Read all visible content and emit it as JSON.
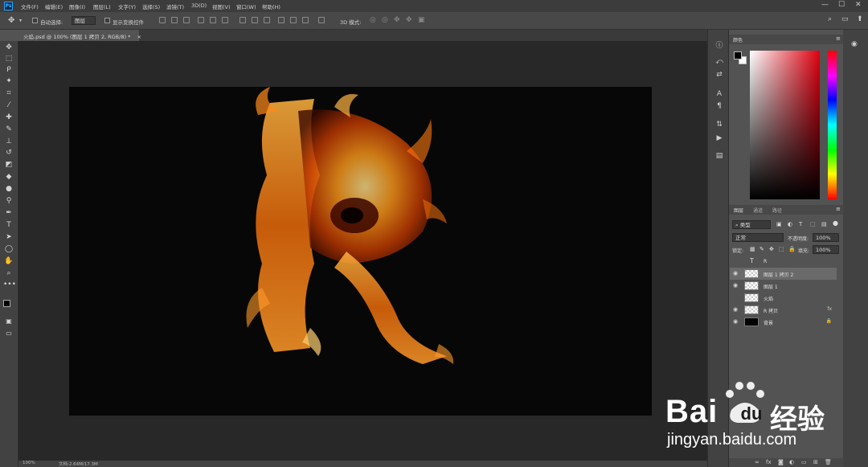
{
  "menubar": {
    "logo": "Ps",
    "items": [
      "文件(F)",
      "编辑(E)",
      "图像(I)",
      "图层(L)",
      "文字(Y)",
      "选择(S)",
      "滤镜(T)",
      "3D(D)",
      "视图(V)",
      "窗口(W)",
      "帮助(H)"
    ],
    "window_controls": [
      "—",
      "☐",
      "✕"
    ]
  },
  "options_bar": {
    "move_icon": "move-icon",
    "auto_select_label": "自动选择:",
    "auto_select_value": "图层",
    "show_transform_label": "显示变换控件",
    "mode_3d_label": "3D 模式:"
  },
  "document": {
    "tab_title": "火焰.psd @ 100% (图层 1 拷贝 2, RGB/8) *",
    "tab_close": "×",
    "bg_color": "#070707"
  },
  "status_bar": {
    "zoom": "100%",
    "doc_info": "文档:2.64M/17.3M"
  },
  "tools": [
    "move",
    "marquee",
    "lasso",
    "magic-wand",
    "crop",
    "eyedropper",
    "healing",
    "brush",
    "stamp",
    "history-brush",
    "eraser",
    "gradient",
    "blur",
    "dodge",
    "pen",
    "type",
    "path-select",
    "shape",
    "hand",
    "zoom",
    "more"
  ],
  "color_panel": {
    "tab": "颜色",
    "foreground": "#000000",
    "background": "#ffffff",
    "picker_hue": "#e00010"
  },
  "layers_panel": {
    "tabs": [
      "图层",
      "通道",
      "路径"
    ],
    "filter_label": "类型",
    "blend_mode": "正常",
    "opacity_label": "不透明度:",
    "opacity_value": "100%",
    "lock_label": "锁定:",
    "fill_label": "填充:",
    "fill_value": "100%",
    "layers": [
      {
        "name": "R",
        "type": "text",
        "visible": false,
        "selected": false
      },
      {
        "name": "图层 1 拷贝 2",
        "type": "image",
        "visible": true,
        "selected": true
      },
      {
        "name": "图层 1",
        "type": "image",
        "visible": true,
        "selected": false
      },
      {
        "name": "火焰",
        "type": "image",
        "visible": false,
        "selected": false
      },
      {
        "name": "R 拷贝",
        "type": "image",
        "visible": true,
        "selected": false,
        "badge": "fx"
      },
      {
        "name": "背景",
        "type": "background",
        "visible": true,
        "selected": false,
        "locked": true
      }
    ]
  },
  "watermark": {
    "brand": "Bai",
    "du": "du",
    "cn": "经验",
    "url": "jingyan.baidu.com"
  }
}
